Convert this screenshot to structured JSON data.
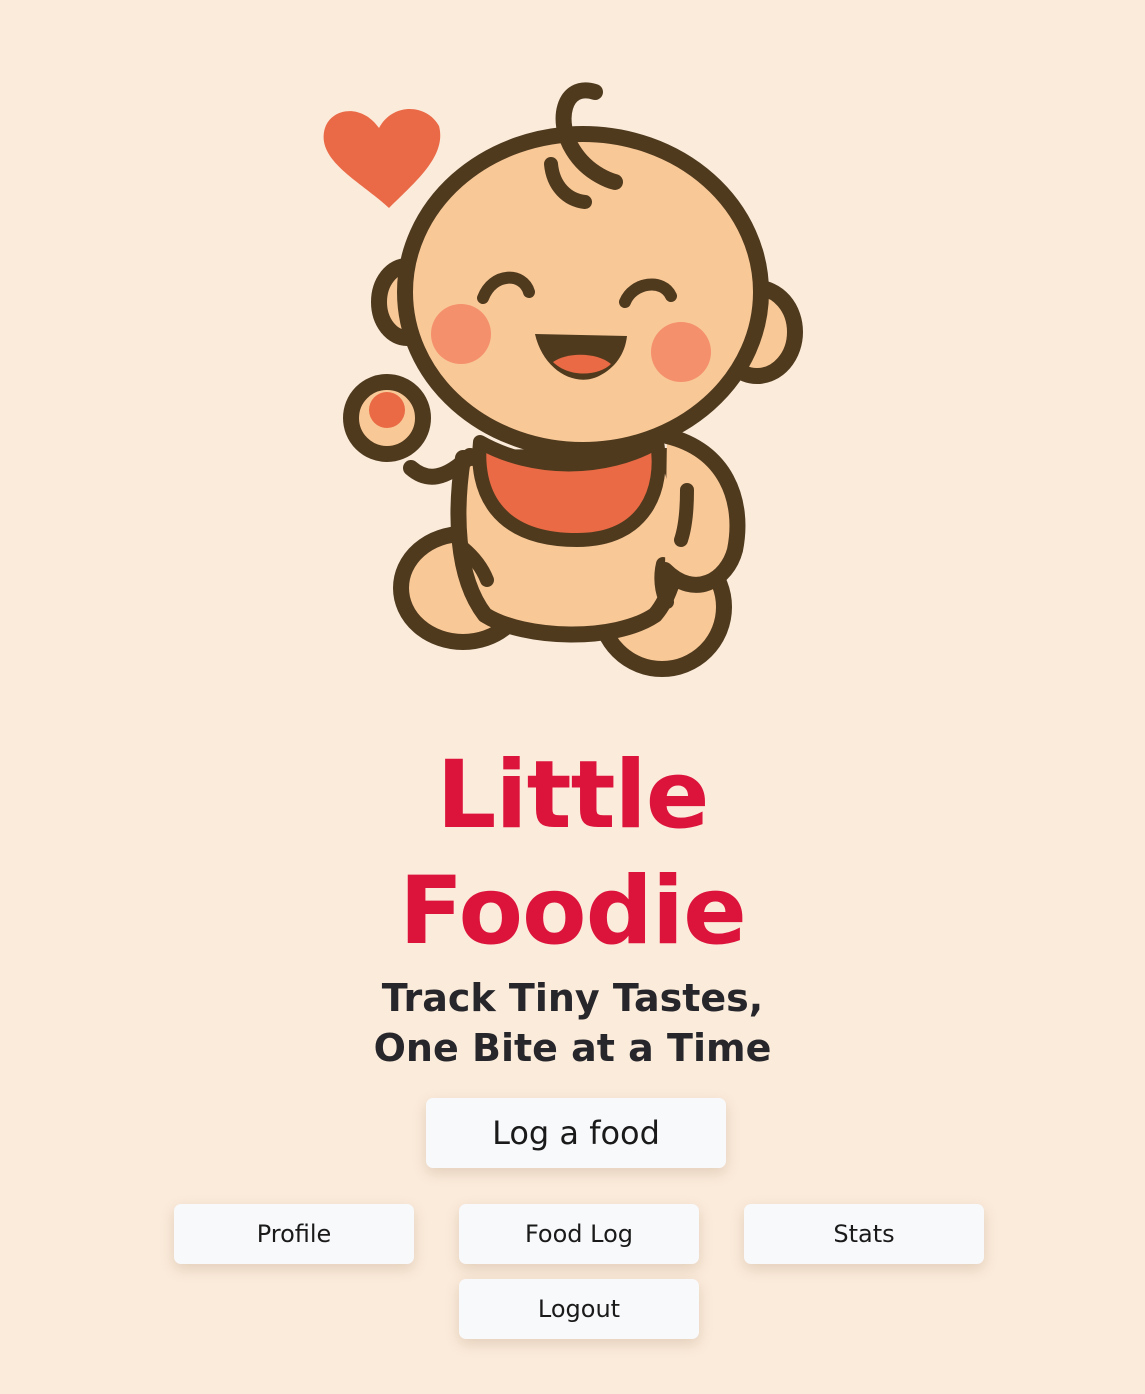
{
  "app": {
    "title_line1": "Little",
    "title_line2": "Foodie",
    "tagline_line1": "Track Tiny Tastes,",
    "tagline_line2": "One Bite at a Time"
  },
  "actions": {
    "primary_label": "Log a food"
  },
  "nav": {
    "items": [
      {
        "label": "Profile"
      },
      {
        "label": "Food Log"
      },
      {
        "label": "Stats"
      },
      {
        "label": "Logout"
      }
    ]
  },
  "mascot": {
    "icon": "happy-baby-with-bib-and-heart-icon",
    "colors": {
      "outline": "#4f3a1e",
      "skin": "#f9c897",
      "bib": "#e96a44",
      "heart": "#ea6a47",
      "cheeks": "#f5906c",
      "mouth": "#e96a44"
    }
  },
  "theme": {
    "background": "#fbebdb",
    "title_color": "#dc143c",
    "tagline_color": "#26262b",
    "button_bg": "#f8f9fb"
  }
}
